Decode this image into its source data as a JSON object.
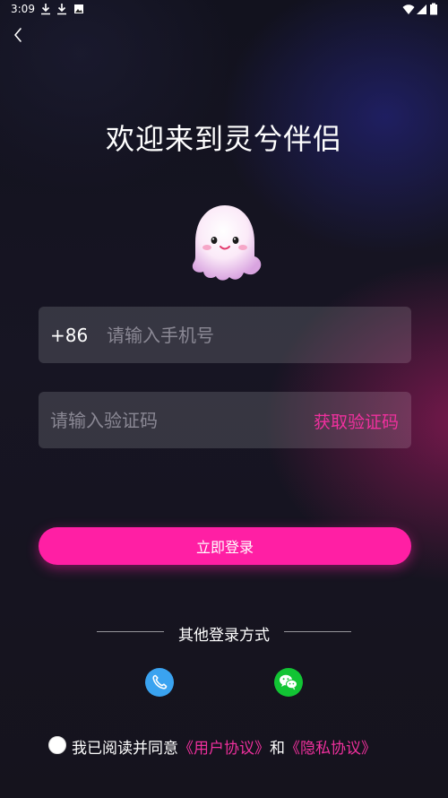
{
  "status_bar": {
    "time": "3:09",
    "left_icons": [
      "download-icon",
      "download-icon",
      "photo-icon"
    ],
    "right_icons": [
      "wifi-icon",
      "signal-icon",
      "battery-icon"
    ]
  },
  "header": {
    "back_icon": "chevron-left-icon"
  },
  "title": "欢迎来到灵兮伴侣",
  "mascot_icon": "ghost-mascot",
  "phone_field": {
    "country_code": "+86",
    "placeholder": "请输入手机号",
    "value": ""
  },
  "code_field": {
    "placeholder": "请输入验证码",
    "value": "",
    "get_code_label": "获取验证码"
  },
  "login_button": {
    "label": "立即登录"
  },
  "other_login": {
    "label": "其他登录方式",
    "methods": [
      {
        "name": "phone",
        "icon": "phone-icon",
        "color": "#3aa3f0"
      },
      {
        "name": "wechat",
        "icon": "wechat-icon",
        "color": "#12c434"
      }
    ]
  },
  "agreement": {
    "checked": false,
    "prefix": "我已阅读并同意",
    "user_agreement": "《用户协议》",
    "and": "和",
    "privacy_policy": "《隐私协议》"
  },
  "colors": {
    "accent": "#ff1fa4",
    "link": "#f0309e"
  }
}
